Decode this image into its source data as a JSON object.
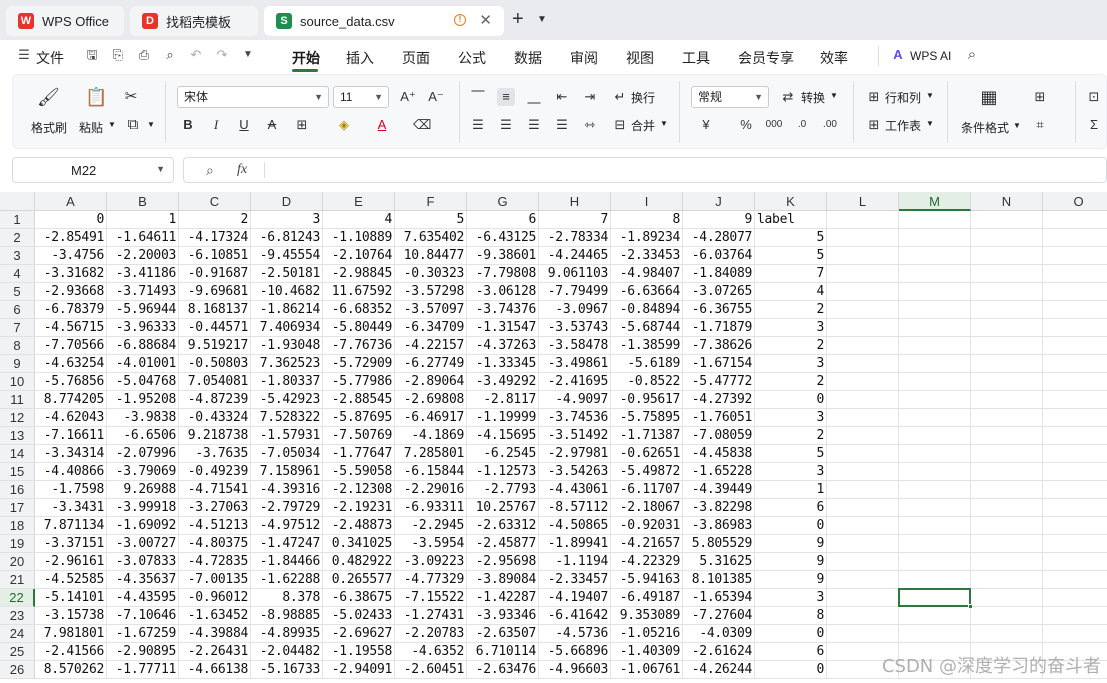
{
  "tabs": [
    {
      "label": "WPS Office",
      "icon": "wps-logo-icon",
      "color": "#e8322d"
    },
    {
      "label": "找稻壳模板",
      "icon": "docer-icon",
      "color": "#e8322d"
    },
    {
      "label": "source_data.csv",
      "icon": "spreadsheet-icon",
      "color": "#1e8e4f",
      "badge": "S"
    }
  ],
  "menu": {
    "file_label": "文件",
    "items": [
      "开始",
      "插入",
      "页面",
      "公式",
      "数据",
      "审阅",
      "视图",
      "工具",
      "会员专享",
      "效率"
    ],
    "active": "开始",
    "wps_ai_label": "WPS AI"
  },
  "ribbon": {
    "format_painter": "格式刷",
    "paste": "粘贴",
    "font_name": "宋体",
    "font_size": "11",
    "wrap_text": "换行",
    "merge": "合并",
    "number_format": "常规",
    "convert": "转换",
    "rows_cols": "行和列",
    "worksheet": "工作表",
    "conditional_format": "条件格式"
  },
  "formula_bar": {
    "name_box": "M22",
    "fx": "fx",
    "content": ""
  },
  "grid": {
    "columns": [
      "A",
      "B",
      "C",
      "D",
      "E",
      "F",
      "G",
      "H",
      "I",
      "J",
      "K",
      "L",
      "M",
      "N",
      "O"
    ],
    "selected_column": "M",
    "selected_row": 22,
    "rows": [
      [
        "1",
        [
          "0",
          "1",
          "2",
          "3",
          "4",
          "5",
          "6",
          "7",
          "8",
          "9",
          "label"
        ]
      ],
      [
        "2",
        [
          "-2.85491",
          "-1.64611",
          "-4.17324",
          "-6.81243",
          "-1.10889",
          "7.635402",
          "-6.43125",
          "-2.78334",
          "-1.89234",
          "-4.28077",
          "5"
        ]
      ],
      [
        "3",
        [
          "-3.4756",
          "-2.20003",
          "-6.10851",
          "-9.45554",
          "-2.10764",
          "10.84477",
          "-9.38601",
          "-4.24465",
          "-2.33453",
          "-6.03764",
          "5"
        ]
      ],
      [
        "4",
        [
          "-3.31682",
          "-3.41186",
          "-0.91687",
          "-2.50181",
          "-2.98845",
          "-0.30323",
          "-7.79808",
          "9.061103",
          "-4.98407",
          "-1.84089",
          "7"
        ]
      ],
      [
        "5",
        [
          "-2.93668",
          "-3.71493",
          "-9.69681",
          "-10.4682",
          "11.67592",
          "-3.57298",
          "-3.06128",
          "-7.79499",
          "-6.63664",
          "-3.07265",
          "4"
        ]
      ],
      [
        "6",
        [
          "-6.78379",
          "-5.96944",
          "8.168137",
          "-1.86214",
          "-6.68352",
          "-3.57097",
          "-3.74376",
          "-3.0967",
          "-0.84894",
          "-6.36755",
          "2"
        ]
      ],
      [
        "7",
        [
          "-4.56715",
          "-3.96333",
          "-0.44571",
          "7.406934",
          "-5.80449",
          "-6.34709",
          "-1.31547",
          "-3.53743",
          "-5.68744",
          "-1.71879",
          "3"
        ]
      ],
      [
        "8",
        [
          "-7.70566",
          "-6.88684",
          "9.519217",
          "-1.93048",
          "-7.76736",
          "-4.22157",
          "-4.37263",
          "-3.58478",
          "-1.38599",
          "-7.38626",
          "2"
        ]
      ],
      [
        "9",
        [
          "-4.63254",
          "-4.01001",
          "-0.50803",
          "7.362523",
          "-5.72909",
          "-6.27749",
          "-1.33345",
          "-3.49861",
          "-5.6189",
          "-1.67154",
          "3"
        ]
      ],
      [
        "10",
        [
          "-5.76856",
          "-5.04768",
          "7.054081",
          "-1.80337",
          "-5.77986",
          "-2.89064",
          "-3.49292",
          "-2.41695",
          "-0.8522",
          "-5.47772",
          "2"
        ]
      ],
      [
        "11",
        [
          "8.774205",
          "-1.95208",
          "-4.87239",
          "-5.42923",
          "-2.88545",
          "-2.69808",
          "-2.8117",
          "-4.9097",
          "-0.95617",
          "-4.27392",
          "0"
        ]
      ],
      [
        "12",
        [
          "-4.62043",
          "-3.9838",
          "-0.43324",
          "7.528322",
          "-5.87695",
          "-6.46917",
          "-1.19999",
          "-3.74536",
          "-5.75895",
          "-1.76051",
          "3"
        ]
      ],
      [
        "13",
        [
          "-7.16611",
          "-6.6506",
          "9.218738",
          "-1.57931",
          "-7.50769",
          "-4.1869",
          "-4.15695",
          "-3.51492",
          "-1.71387",
          "-7.08059",
          "2"
        ]
      ],
      [
        "14",
        [
          "-3.34314",
          "-2.07996",
          "-3.7635",
          "-7.05034",
          "-1.77647",
          "7.285801",
          "-6.2545",
          "-2.97981",
          "-0.62651",
          "-4.45838",
          "5"
        ]
      ],
      [
        "15",
        [
          "-4.40866",
          "-3.79069",
          "-0.49239",
          "7.158961",
          "-5.59058",
          "-6.15844",
          "-1.12573",
          "-3.54263",
          "-5.49872",
          "-1.65228",
          "3"
        ]
      ],
      [
        "16",
        [
          "-1.7598",
          "9.26988",
          "-4.71541",
          "-4.39316",
          "-2.12308",
          "-2.29016",
          "-2.7793",
          "-4.43061",
          "-6.11707",
          "-4.39449",
          "1"
        ]
      ],
      [
        "17",
        [
          "-3.3431",
          "-3.99918",
          "-3.27063",
          "-2.79729",
          "-2.19231",
          "-6.93311",
          "10.25767",
          "-8.57112",
          "-2.18067",
          "-3.82298",
          "6"
        ]
      ],
      [
        "18",
        [
          "7.871134",
          "-1.69092",
          "-4.51213",
          "-4.97512",
          "-2.48873",
          "-2.2945",
          "-2.63312",
          "-4.50865",
          "-0.92031",
          "-3.86983",
          "0"
        ]
      ],
      [
        "19",
        [
          "-3.37151",
          "-3.00727",
          "-4.80375",
          "-1.47247",
          "0.341025",
          "-3.5954",
          "-2.45877",
          "-1.89941",
          "-4.21657",
          "5.805529",
          "9"
        ]
      ],
      [
        "20",
        [
          "-2.96161",
          "-3.07833",
          "-4.72835",
          "-1.84466",
          "0.482922",
          "-3.09223",
          "-2.95698",
          "-1.1194",
          "-4.22329",
          "5.31625",
          "9"
        ]
      ],
      [
        "21",
        [
          "-4.52585",
          "-4.35637",
          "-7.00135",
          "-1.62288",
          "0.265577",
          "-4.77329",
          "-3.89084",
          "-2.33457",
          "-5.94163",
          "8.101385",
          "9"
        ]
      ],
      [
        "22",
        [
          "-5.14101",
          "-4.43595",
          "-0.96012",
          "8.378",
          "-6.38675",
          "-7.15522",
          "-1.42287",
          "-4.19407",
          "-6.49187",
          "-1.65394",
          "3"
        ]
      ],
      [
        "23",
        [
          "-3.15738",
          "-7.10646",
          "-1.63452",
          "-8.98885",
          "-5.02433",
          "-1.27431",
          "-3.93346",
          "-6.41642",
          "9.353089",
          "-7.27604",
          "8"
        ]
      ],
      [
        "24",
        [
          "7.981801",
          "-1.67259",
          "-4.39884",
          "-4.89935",
          "-2.69627",
          "-2.20783",
          "-2.63507",
          "-4.5736",
          "-1.05216",
          "-4.0309",
          "0"
        ]
      ],
      [
        "25",
        [
          "-2.41566",
          "-2.90895",
          "-2.26431",
          "-2.04482",
          "-1.19558",
          "-4.6352",
          "6.710114",
          "-5.66896",
          "-1.40309",
          "-2.61624",
          "6"
        ]
      ],
      [
        "26",
        [
          "8.570262",
          "-1.77711",
          "-4.66138",
          "-5.16733",
          "-2.94091",
          "-2.60451",
          "-2.63476",
          "-4.96603",
          "-1.06761",
          "-4.26244",
          "0"
        ]
      ]
    ]
  },
  "watermark": "CSDN @深度学习的奋斗者",
  "colors": {
    "accent": "#2b7a3d",
    "tab_bar": "#e9ebef",
    "header_bg": "#f1f2f4"
  }
}
